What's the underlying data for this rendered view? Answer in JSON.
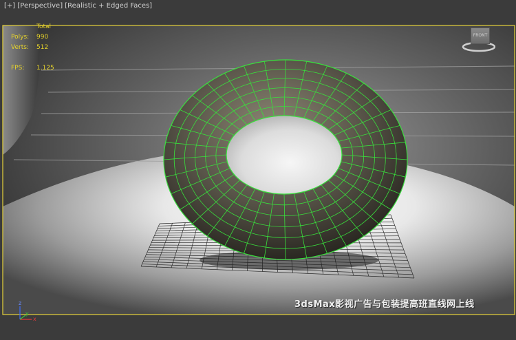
{
  "viewport": {
    "label_parts": [
      "[+]",
      "[Perspective]",
      "[Realistic + Edged Faces]"
    ]
  },
  "stats": {
    "header": "Total",
    "polys_label": "Polys:",
    "polys_value": "990",
    "verts_label": "Verts:",
    "verts_value": "512",
    "fps_label": "FPS:",
    "fps_value": "1.125"
  },
  "viewcube": {
    "face_label": "FRONT"
  },
  "axis_tripod": {
    "z": "z",
    "y": "y",
    "x": "x"
  },
  "watermark": "3dsMax影视广告与包装提高班直线网上线",
  "colors": {
    "border": "#e6d23a",
    "wire": "#39e03c",
    "stats_text": "#e8d42a"
  }
}
